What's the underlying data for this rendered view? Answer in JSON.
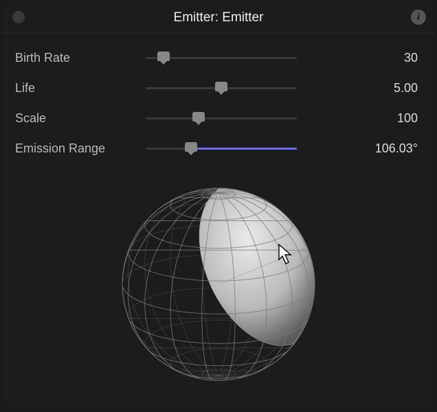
{
  "header": {
    "title": "Emitter: Emitter",
    "info_tooltip": "i"
  },
  "params": [
    {
      "label": "Birth Rate",
      "value": "30",
      "pos": 0.12,
      "fill": false
    },
    {
      "label": "Life",
      "value": "5.00",
      "pos": 0.5,
      "fill": false
    },
    {
      "label": "Scale",
      "value": "100",
      "pos": 0.35,
      "fill": false
    },
    {
      "label": "Emission Range",
      "value": "106.03°",
      "pos": 0.3,
      "fill": true
    }
  ],
  "emission_preview": {
    "azimuth_deg": 50,
    "range_deg": 106.03,
    "sphere_radius": 140
  }
}
